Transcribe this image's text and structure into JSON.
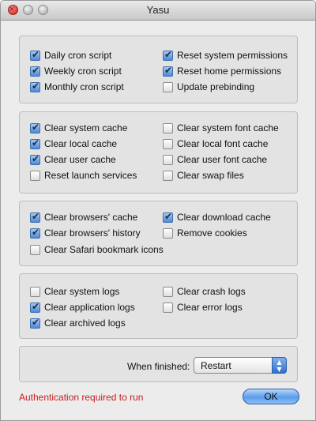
{
  "window": {
    "title": "Yasu"
  },
  "groups": [
    {
      "options": [
        {
          "label": "Daily cron script",
          "checked": true
        },
        {
          "label": "Weekly cron script",
          "checked": true
        },
        {
          "label": "Monthly cron script",
          "checked": true
        },
        {
          "label": "Reset system permissions",
          "checked": true
        },
        {
          "label": "Reset home permissions",
          "checked": true
        },
        {
          "label": "Update prebinding",
          "checked": false
        }
      ]
    },
    {
      "options": [
        {
          "label": "Clear system cache",
          "checked": true
        },
        {
          "label": "Clear local cache",
          "checked": true
        },
        {
          "label": "Clear user cache",
          "checked": true
        },
        {
          "label": "Reset launch services",
          "checked": false
        },
        {
          "label": "Clear system font cache",
          "checked": false
        },
        {
          "label": "Clear local font cache",
          "checked": false
        },
        {
          "label": "Clear user font cache",
          "checked": false
        },
        {
          "label": "Clear swap files",
          "checked": false
        }
      ]
    },
    {
      "options": [
        {
          "label": "Clear browsers' cache",
          "checked": true
        },
        {
          "label": "Clear browsers' history",
          "checked": true
        },
        {
          "label": "Clear Safari bookmark icons",
          "checked": false
        },
        {
          "label": "Clear download cache",
          "checked": true
        },
        {
          "label": "Remove cookies",
          "checked": false
        }
      ]
    },
    {
      "options": [
        {
          "label": "Clear system logs",
          "checked": false
        },
        {
          "label": "Clear application logs",
          "checked": true
        },
        {
          "label": "Clear archived logs",
          "checked": true
        },
        {
          "label": "Clear crash logs",
          "checked": false
        },
        {
          "label": "Clear error logs",
          "checked": false
        }
      ]
    }
  ],
  "footer": {
    "when_finished_label": "When finished:",
    "when_finished_value": "Restart",
    "auth_message": "Authentication required to run",
    "ok_label": "OK"
  }
}
